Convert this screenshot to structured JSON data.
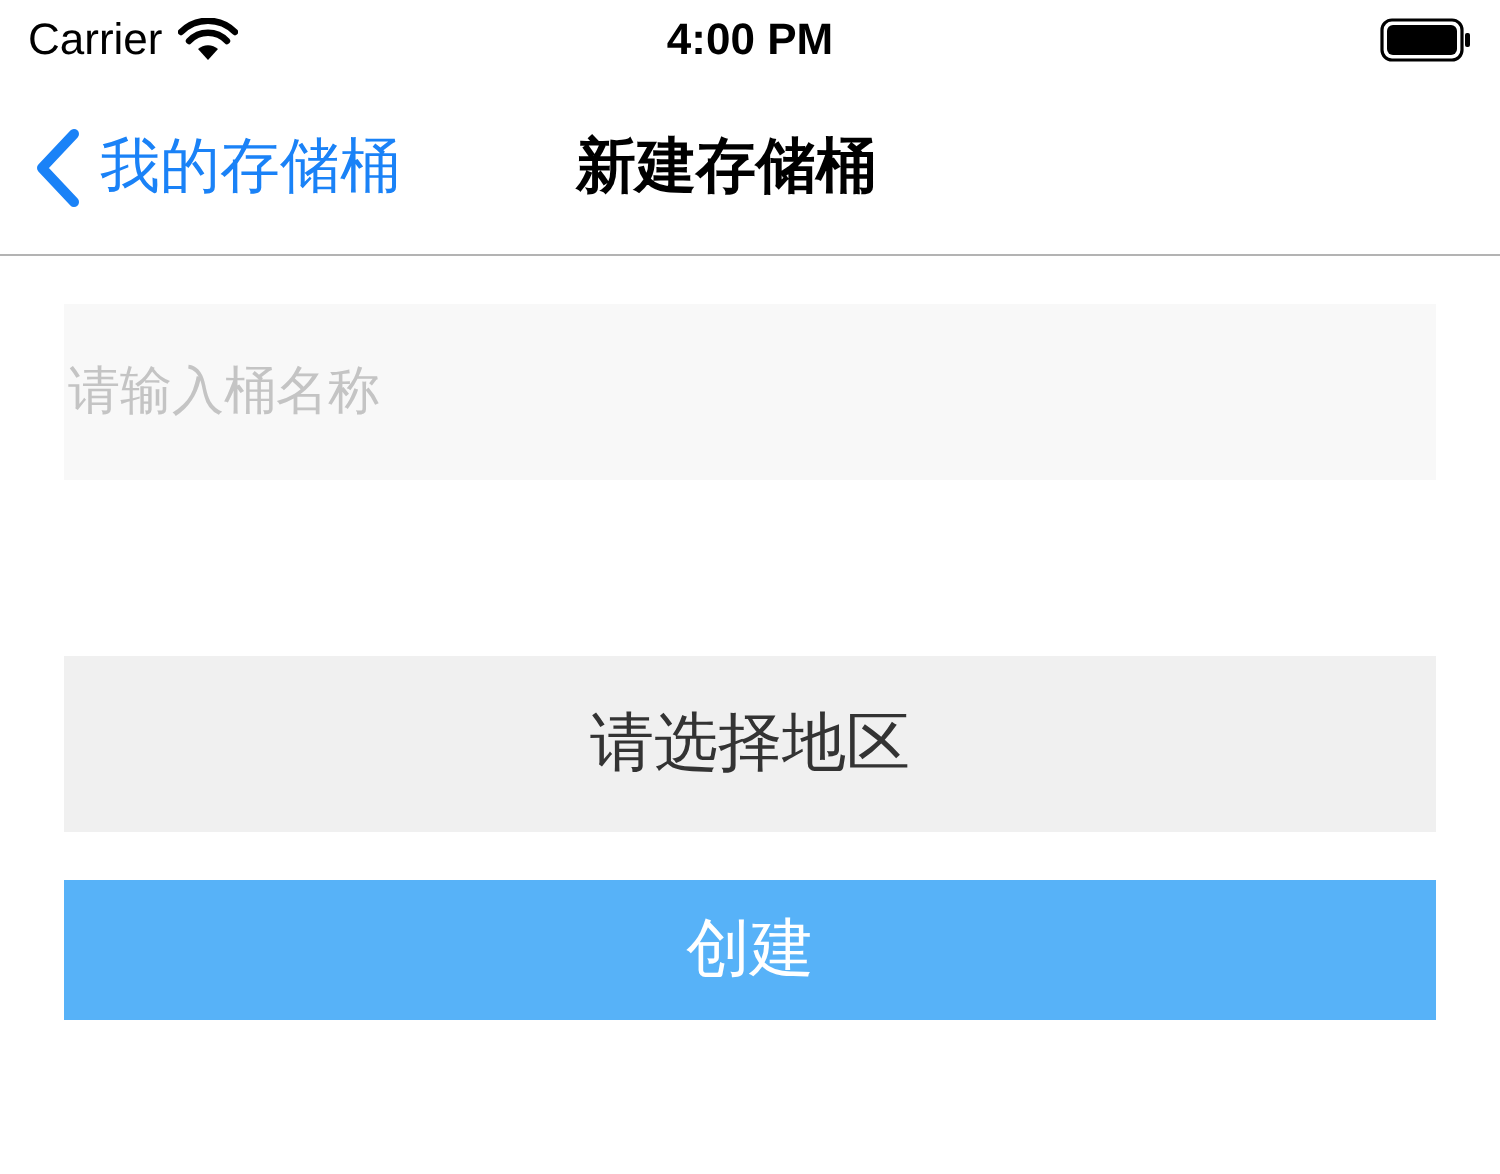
{
  "status_bar": {
    "carrier": "Carrier",
    "time": "4:00 PM"
  },
  "nav_bar": {
    "back_label": "我的存储桶",
    "title": "新建存储桶"
  },
  "name_field": {
    "placeholder": "请输入桶名称"
  },
  "region_button": {
    "label": "请选择地区"
  },
  "create_button": {
    "label": "创建"
  }
}
